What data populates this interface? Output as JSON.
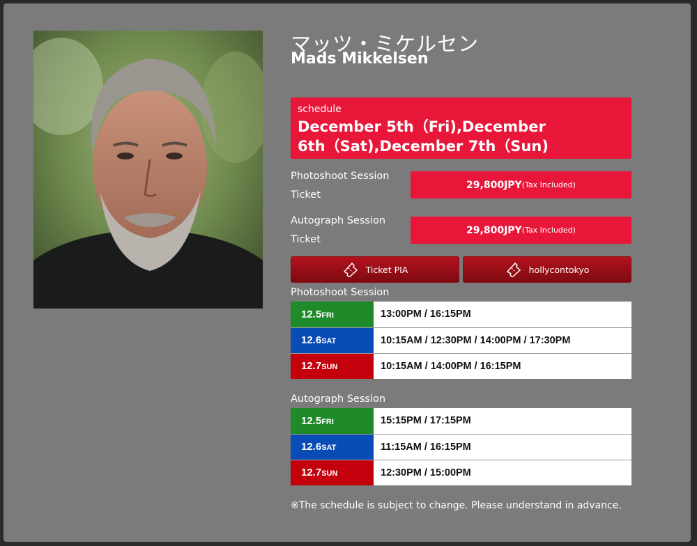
{
  "artist": {
    "name_jp": "マッツ・ミケルセン",
    "name_en": "Mads Mikkelsen"
  },
  "schedule": {
    "label": "schedule",
    "dates": "December 5th（Fri),December 6th（Sat),December 7th（Sun)"
  },
  "tickets": [
    {
      "label": "Photoshoot Session Ticket",
      "price": "29,800JPY",
      "tax": "(Tax Included)"
    },
    {
      "label": "Autograph Session Ticket",
      "price": "29,800JPY",
      "tax": "(Tax Included)"
    }
  ],
  "buttons": [
    {
      "label": "Ticket PIA",
      "icon": "ticket-icon"
    },
    {
      "label": "hollycontokyo",
      "icon": "ticket-icon"
    }
  ],
  "photoshoot": {
    "title": "Photoshoot Session",
    "rows": [
      {
        "date": "12.5",
        "dow": "FRI",
        "color": "#1f8a2a",
        "times": "13:00PM / 16:15PM"
      },
      {
        "date": "12.6",
        "dow": "SAT",
        "color": "#0a4cb6",
        "times": "10:15AM / 12:30PM / 14:00PM / 17:30PM"
      },
      {
        "date": "12.7",
        "dow": "SUN",
        "color": "#c4000c",
        "times": "10:15AM / 14:00PM / 16:15PM"
      }
    ]
  },
  "autograph": {
    "title": "Autograph Session",
    "rows": [
      {
        "date": "12.5",
        "dow": "FRI",
        "color": "#1f8a2a",
        "times": "15:15PM / 17:15PM"
      },
      {
        "date": "12.6",
        "dow": "SAT",
        "color": "#0a4cb6",
        "times": "11:15AM / 16:15PM"
      },
      {
        "date": "12.7",
        "dow": "SUN",
        "color": "#c4000c",
        "times": "12:30PM / 15:00PM"
      }
    ]
  },
  "note": "※The schedule is subject to change. Please understand in advance.",
  "colors": {
    "accent_red": "#e8173a",
    "button_red": "#a3101a",
    "panel_gray": "#7b7b7b"
  }
}
